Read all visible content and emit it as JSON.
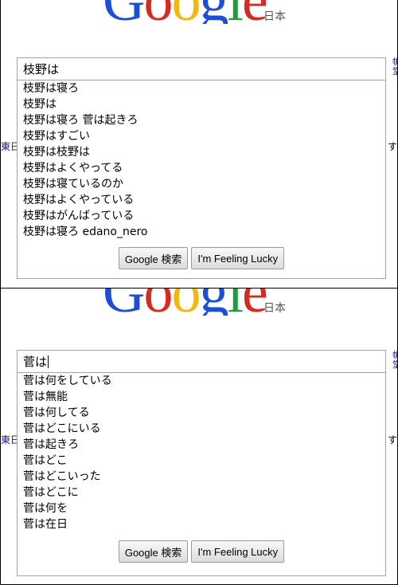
{
  "logo": {
    "letters": [
      {
        "char": "G",
        "color": "#1a4fd6"
      },
      {
        "char": "o",
        "color": "#d62b1f"
      },
      {
        "char": "o",
        "color": "#f2b90c"
      },
      {
        "char": "g",
        "color": "#1a4fd6"
      },
      {
        "char": "l",
        "color": "#239a3b"
      },
      {
        "char": "e",
        "color": "#d62b1f"
      }
    ],
    "region_label": "日本"
  },
  "edge_text": {
    "left": "東日",
    "right": "す",
    "right_top": "帆 堂"
  },
  "panels": [
    {
      "query": "枝野は",
      "suggestions": [
        "枝野は寝ろ",
        "枝野は",
        "枝野は寝ろ 菅は起きろ",
        "枝野はすごい",
        "枝野は枝野は",
        "枝野はよくやってる",
        "枝野は寝ているのか",
        "枝野はよくやっている",
        "枝野はがんばっている",
        "枝野は寝ろ edano_nero"
      ]
    },
    {
      "query": "菅は",
      "suggestions": [
        "菅は何をしている",
        "菅は無能",
        "菅は何してる",
        "菅はどこにいる",
        "菅は起きろ",
        "菅はどこ",
        "菅はどこいった",
        "菅はどこに",
        "菅は何を",
        "菅は在日"
      ]
    }
  ],
  "buttons": {
    "search": "Google 検索",
    "lucky": "I'm Feeling Lucky"
  }
}
